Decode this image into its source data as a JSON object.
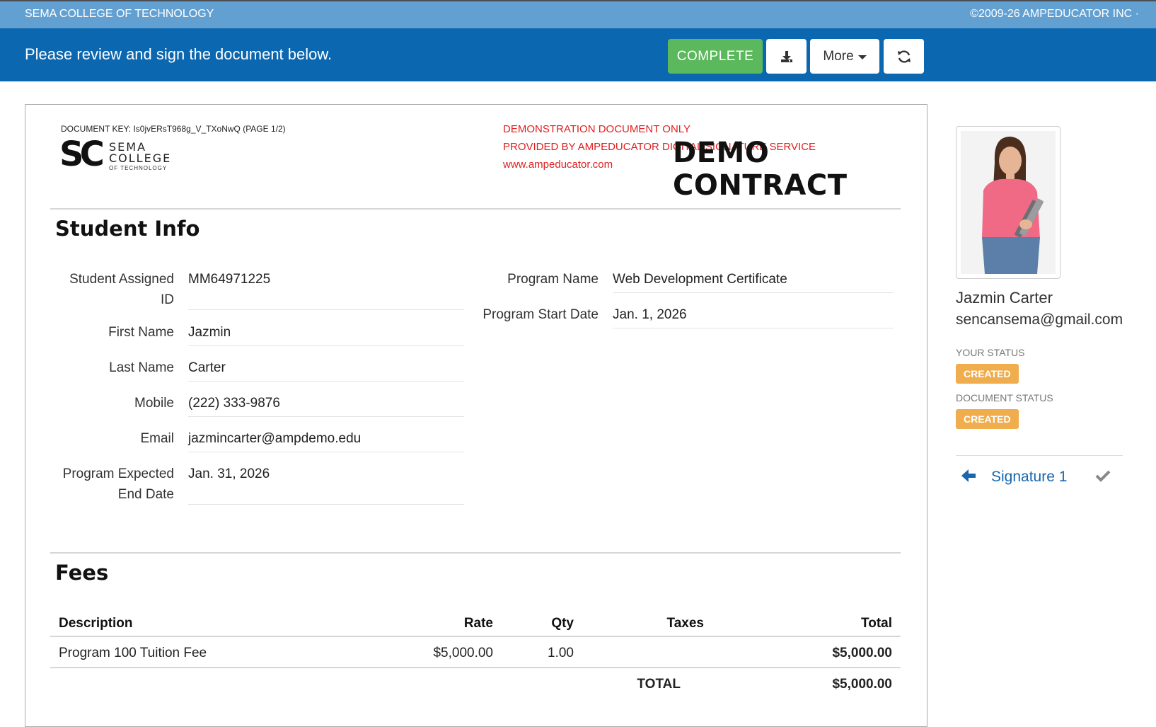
{
  "header": {
    "org_name": "SEMA COLLEGE OF TECHNOLOGY",
    "copyright": "©2009-26 AMPEDUCATOR INC ·"
  },
  "toolbar": {
    "message": "Please review and sign the document below.",
    "complete_label": "COMPLETE",
    "download_icon": "download-icon",
    "more_label": "More",
    "refresh_icon": "refresh-icon",
    "colors": {
      "bar": "#0b67b0",
      "complete": "#5cb85c"
    }
  },
  "document": {
    "doc_key": "DOCUMENT KEY: Is0jvERsT968g_V_TXoNwQ (PAGE 1/2)",
    "logo": {
      "mark": "SC",
      "line1": "SEMA",
      "line2": "COLLEGE",
      "line3": "OF TECHNOLOGY"
    },
    "demo_lines": [
      "DEMONSTRATION DOCUMENT ONLY",
      "PROVIDED BY AMPEDUCATOR DIGITAL SIGNATURE SERVICE",
      "www.ampeducator.com"
    ],
    "title": "DEMO CONTRACT",
    "student_info": {
      "heading": "Student Info",
      "fields": {
        "student_id": {
          "label": "Student Assigned ID",
          "value": "MM64971225"
        },
        "first_name": {
          "label": "First Name",
          "value": "Jazmin"
        },
        "last_name": {
          "label": "Last Name",
          "value": "Carter"
        },
        "mobile": {
          "label": "Mobile",
          "value": "(222) 333-9876"
        },
        "email": {
          "label": "Email",
          "value": "jazmincarter@ampdemo.edu"
        },
        "end_date": {
          "label": "Program Expected End Date",
          "value": "Jan. 31, 2026"
        },
        "program_name": {
          "label": "Program Name",
          "value": "Web Development Certificate"
        },
        "start_date": {
          "label": "Program Start Date",
          "value": "Jan. 1, 2026"
        }
      }
    },
    "fees": {
      "heading": "Fees",
      "columns": [
        "Description",
        "Rate",
        "Qty",
        "Taxes",
        "Total"
      ],
      "rows": [
        {
          "description": "Program 100 Tuition Fee",
          "rate": "$5,000.00",
          "qty": "1.00",
          "taxes": "",
          "total": "$5,000.00"
        }
      ],
      "total_label": "TOTAL",
      "total_value": "$5,000.00"
    }
  },
  "sidebar": {
    "signer_name": "Jazmin Carter",
    "signer_email": "sencansema@gmail.com",
    "your_status_label": "YOUR STATUS",
    "your_status": "CREATED",
    "document_status_label": "DOCUMENT STATUS",
    "document_status": "CREATED",
    "signature_label": "Signature 1",
    "signature_icons": {
      "left": "arrow-left-icon",
      "right": "check-icon"
    },
    "status_color": "#f0ad4e"
  }
}
